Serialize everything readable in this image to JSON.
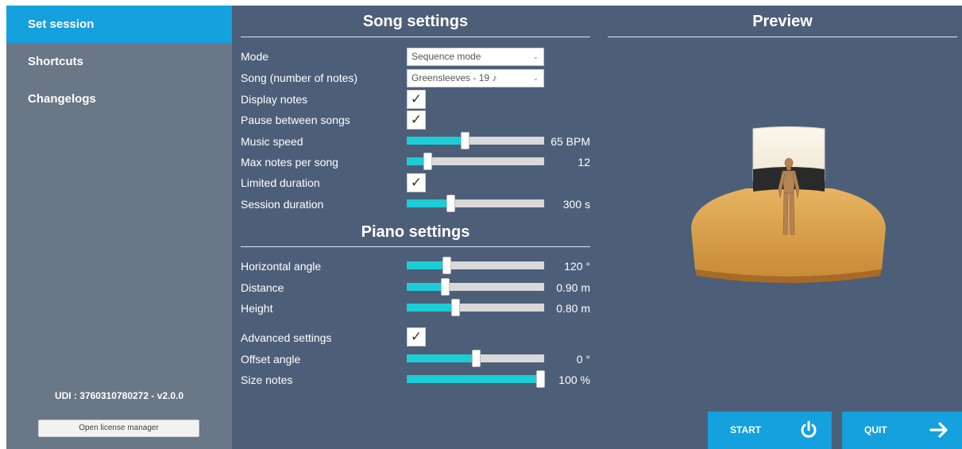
{
  "sidebar": {
    "items": [
      {
        "label": "Set session",
        "active": true
      },
      {
        "label": "Shortcuts",
        "active": false
      },
      {
        "label": "Changelogs",
        "active": false
      }
    ],
    "udi": "UDI : 3760310780272 - v2.0.0",
    "license_button": "Open license manager"
  },
  "song_settings": {
    "title": "Song settings",
    "mode_label": "Mode",
    "mode_value": "Sequence mode",
    "song_label": "Song (number of notes)",
    "song_value": "Greensleeves - 19 ♪",
    "display_notes_label": "Display notes",
    "display_notes_checked": true,
    "pause_label": "Pause between songs",
    "pause_checked": true,
    "music_speed_label": "Music speed",
    "music_speed_value": "65 BPM",
    "music_speed_fraction": 0.42,
    "max_notes_label": "Max notes per song",
    "max_notes_value": "12",
    "max_notes_fraction": 0.15,
    "limited_duration_label": "Limited duration",
    "limited_duration_checked": true,
    "session_duration_label": "Session duration",
    "session_duration_value": "300 s",
    "session_duration_fraction": 0.32
  },
  "piano_settings": {
    "title": "Piano settings",
    "horizontal_angle_label": "Horizontal angle",
    "horizontal_angle_value": "120 °",
    "horizontal_angle_fraction": 0.29,
    "distance_label": "Distance",
    "distance_value": "0.90 m",
    "distance_fraction": 0.28,
    "height_label": "Height",
    "height_value": "0.80 m",
    "height_fraction": 0.35,
    "advanced_label": "Advanced settings",
    "advanced_checked": true,
    "offset_angle_label": "Offset angle",
    "offset_angle_value": "0 °",
    "offset_angle_fraction": 0.5,
    "size_notes_label": "Size notes",
    "size_notes_value": "100 %",
    "size_notes_fraction": 0.97
  },
  "preview": {
    "title": "Preview"
  },
  "buttons": {
    "start": "START",
    "quit": "QUIT"
  },
  "colors": {
    "accent": "#15a0de",
    "slider_fill": "#1ccdd6",
    "panel": "#4d5f78",
    "sidebar": "#6a7786"
  },
  "icons": {
    "check": "check-icon",
    "dropdown": "chevron-down-icon",
    "start": "power-icon",
    "quit": "arrow-right-icon"
  }
}
